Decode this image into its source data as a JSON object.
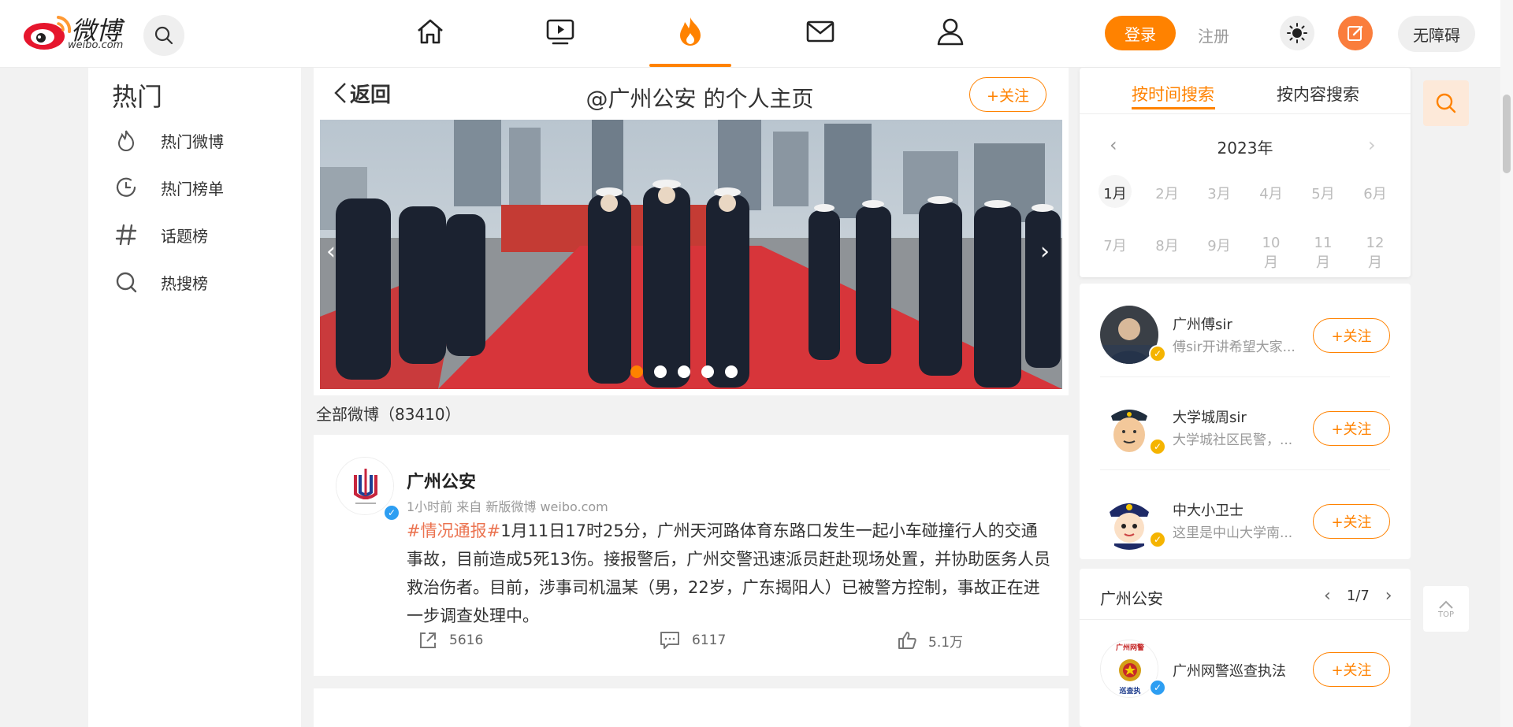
{
  "header": {
    "logo_text": "微博",
    "logo_sub": "weibo.com",
    "login_label": "登录",
    "register_label": "注册",
    "accessibility_label": "无障碍",
    "colors": {
      "accent": "#ff8200",
      "write": "#fa7d3c"
    }
  },
  "sidebar": {
    "title": "热门",
    "items": [
      {
        "label": "热门微博",
        "icon": "flame-icon"
      },
      {
        "label": "热门榜单",
        "icon": "clock-icon"
      },
      {
        "label": "话题榜",
        "icon": "hashtag-icon"
      },
      {
        "label": "热搜榜",
        "icon": "search-icon"
      }
    ]
  },
  "profile": {
    "back_label": "返回",
    "title": "@广州公安 的个人主页",
    "follow_label": "+关注",
    "banner_dots": 5,
    "banner_active": 0
  },
  "feed": {
    "count_label": "全部微博（83410）",
    "post": {
      "author": "广州公安",
      "meta": "1小时前  来自 新版微博 weibo.com",
      "tag": "#情况通报#",
      "text": "1月11日17时25分，广州天河路体育东路口发生一起小车碰撞行人的交通事故，目前造成5死13伤。接报警后，广州交警迅速派员赶赴现场处置，并协助医务人员救治伤者。目前，涉事司机温某（男，22岁，广东揭阳人）已被警方控制，事故正在进一步调查处理中。",
      "reposts": "5616",
      "comments": "6117",
      "likes": "5.1万"
    }
  },
  "search_panel": {
    "tab_time": "按时间搜索",
    "tab_content": "按内容搜索",
    "year": "2023年",
    "months_row1": [
      "1月",
      "2月",
      "3月",
      "4月",
      "5月",
      "6月"
    ],
    "months_row2": [
      "7月",
      "8月",
      "9月",
      "10月",
      "11月",
      "12月"
    ]
  },
  "recommend": [
    {
      "name": "广州傅sir",
      "desc": "傅sir开讲希望大家...",
      "follow": "+关注"
    },
    {
      "name": "大学城周sir",
      "desc": "大学城社区民警，...",
      "follow": "+关注"
    },
    {
      "name": "中大小卫士",
      "desc": "这里是中山大学南...",
      "follow": "+关注"
    }
  ],
  "related": {
    "title": "广州公安",
    "pager": "1/7",
    "item": {
      "name": "广州网警巡查执法",
      "follow": "+关注",
      "avatar_text_top": "广州网警",
      "avatar_text_bottom": "巡查执"
    }
  },
  "top_label": "TOP"
}
